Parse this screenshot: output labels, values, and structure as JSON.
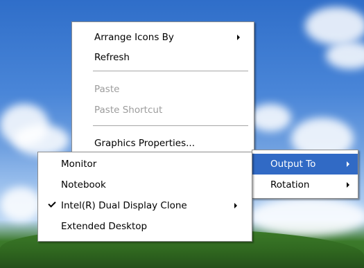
{
  "desktop_menu": {
    "items": [
      {
        "label": "Arrange Icons By",
        "submenu": true
      },
      {
        "label": "Refresh"
      },
      {
        "label": "Paste",
        "disabled": true
      },
      {
        "label": "Paste Shortcut",
        "disabled": true
      },
      {
        "label": "Graphics Properties..."
      }
    ]
  },
  "graphics_submenu": {
    "items": [
      {
        "label": "Output To",
        "highlighted": true,
        "submenu": true
      },
      {
        "label": "Rotation",
        "submenu": true
      }
    ]
  },
  "output_submenu": {
    "items": [
      {
        "label": "Monitor"
      },
      {
        "label": "Notebook"
      },
      {
        "label": "Intel(R) Dual Display Clone",
        "checked": true,
        "submenu": true
      },
      {
        "label": "Extended Desktop"
      }
    ]
  },
  "colors": {
    "highlight": "#316ac5",
    "disabled_text": "#9c9c9c"
  }
}
